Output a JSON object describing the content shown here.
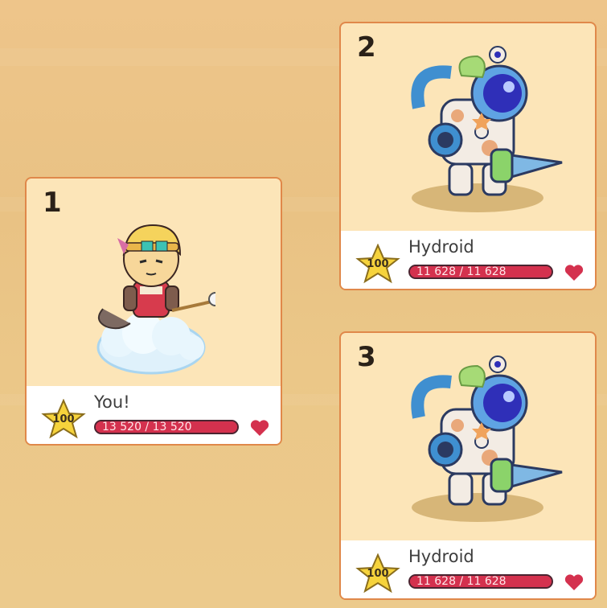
{
  "players": [
    {
      "rank": "1",
      "name": "You!",
      "level": "100",
      "hp_text": "13 520 / 13 520",
      "hp_fraction": 1.0
    },
    {
      "rank": "2",
      "name": "Hydroid",
      "level": "100",
      "hp_text": "11 628 / 11 628",
      "hp_fraction": 1.0
    },
    {
      "rank": "3",
      "name": "Hydroid",
      "level": "100",
      "hp_text": "11 628 / 11 628",
      "hp_fraction": 1.0
    }
  ],
  "colors": {
    "card_border": "#e0884a",
    "card_bg": "#fce5b8",
    "hp_bar": "#d4314e",
    "heart": "#d4314e",
    "star": "#f6d33c"
  },
  "icons": [
    "star-level-icon",
    "heart-icon"
  ]
}
